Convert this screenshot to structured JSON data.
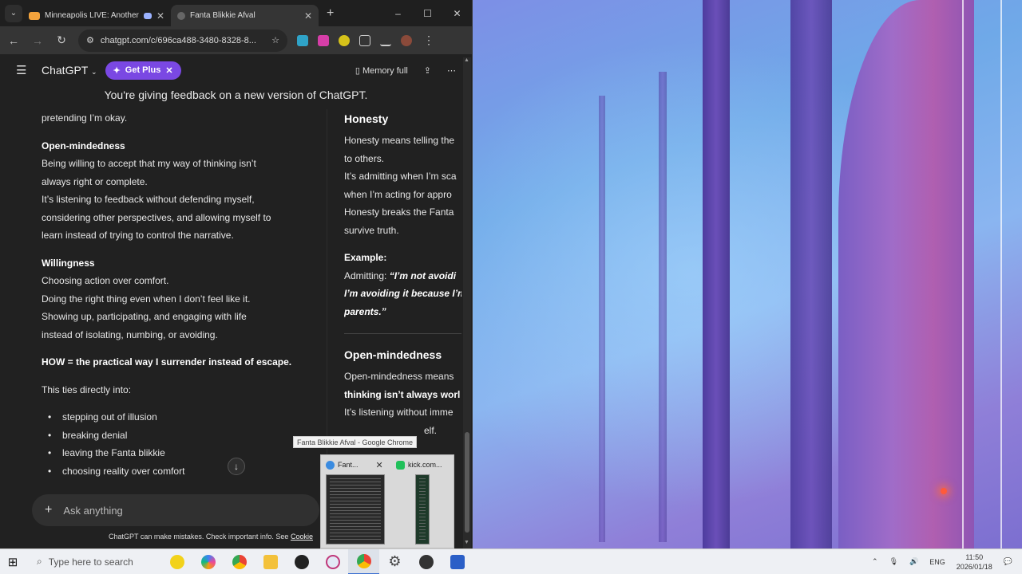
{
  "browser": {
    "tabs": [
      {
        "title": "Minneapolis LIVE: Another I",
        "active": false
      },
      {
        "title": "Fanta Blikkie Afval",
        "active": true
      }
    ],
    "url": "chatgpt.com/c/696ca488-3480-8328-8...",
    "window_controls": {
      "minimize": "–",
      "maximize": "☐",
      "close": "✕"
    }
  },
  "chatgpt": {
    "brand": "ChatGPT",
    "get_plus": "Get Plus",
    "memory": "Memory full",
    "feedback_title": "You're giving feedback on a new version of ChatGPT.",
    "composer_placeholder": "Ask anything",
    "disclaimer": "ChatGPT can make mistakes. Check important info. See",
    "disclaimer_link": "Cookie"
  },
  "left_response": {
    "p0": "pretending I’m okay.",
    "h_open": "Open-mindedness",
    "open_1": "Being willing to accept that my way of thinking isn’t",
    "open_2": "always right or complete.",
    "open_3": "It’s listening to feedback without defending myself,",
    "open_4": "considering other perspectives, and allowing myself to",
    "open_5": "learn instead of trying to control the narrative.",
    "h_will": "Willingness",
    "will_1": "Choosing action over comfort.",
    "will_2": "Doing the right thing even when I don’t feel like it.",
    "will_3": "Showing up, participating, and engaging with life",
    "will_4": "instead of isolating, numbing, or avoiding.",
    "how": "HOW = the practical way I surrender instead of escape.",
    "ties": "This ties directly into:",
    "bullets": [
      "stepping out of illusion",
      "breaking denial",
      "leaving the Fanta blikkie",
      "choosing reality over comfort"
    ]
  },
  "right_response": {
    "h_honesty": "Honesty",
    "hon_1": "Honesty means telling the",
    "hon_2": "to others.",
    "hon_3": "It’s admitting when I’m sca",
    "hon_4": "when I’m acting for appro",
    "hon_5": "Honesty breaks the Fanta",
    "hon_6": "survive truth.",
    "example_label": "Example:",
    "admit_label": "Admitting:",
    "admit_q1": "“I’m not avoidi",
    "admit_q2": "I’m avoiding it because I’m",
    "admit_q3": "parents.”",
    "h_open": "Open-mindedness",
    "open_1": "Open-mindedness means",
    "open_2": "thinking isn’t always worl",
    "open_3": "It’s listening without imme",
    "open_4": "elf."
  },
  "taskbar_preview": {
    "tooltip": "Fanta Blikkie Afval - Google Chrome",
    "item1": "Fant...",
    "item2": "kick.com..."
  },
  "taskbar": {
    "search_placeholder": "Type here to search",
    "lang": "ENG",
    "time": "11:50",
    "date": "2026/01/18"
  },
  "colors": {
    "accent_plus": "#7a48e3",
    "chat_bg": "#212121"
  }
}
